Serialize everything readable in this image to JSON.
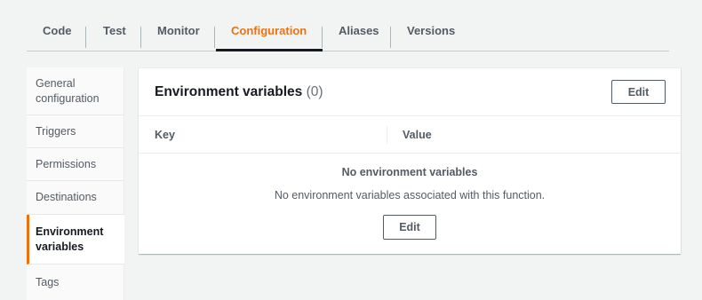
{
  "tabs": [
    {
      "label": "Code"
    },
    {
      "label": "Test"
    },
    {
      "label": "Monitor"
    },
    {
      "label": "Configuration",
      "active": true
    },
    {
      "label": "Aliases"
    },
    {
      "label": "Versions"
    }
  ],
  "sidebar": {
    "items": [
      {
        "label": "General configuration"
      },
      {
        "label": "Triggers"
      },
      {
        "label": "Permissions"
      },
      {
        "label": "Destinations"
      },
      {
        "label": "Environment variables",
        "active": true
      },
      {
        "label": "Tags"
      }
    ]
  },
  "panel": {
    "title": "Environment variables",
    "count": "(0)",
    "edit_label": "Edit",
    "columns": [
      "Key",
      "Value"
    ],
    "empty_title": "No environment variables",
    "empty_description": "No environment variables associated with this function.",
    "empty_edit_label": "Edit"
  },
  "colors": {
    "accent": "#ec7211",
    "text": "#16191f",
    "muted": "#545b64",
    "background": "#f2f3f3"
  }
}
